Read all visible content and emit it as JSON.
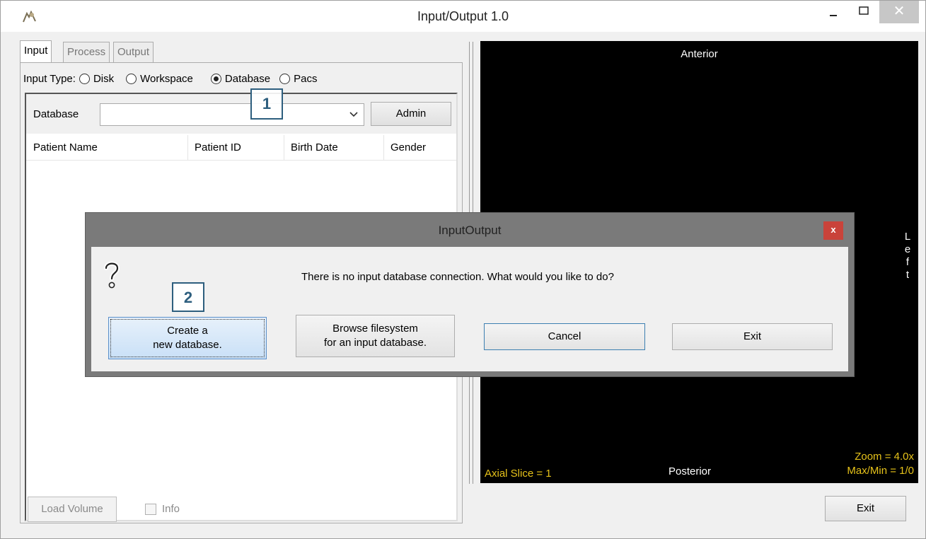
{
  "window": {
    "title": "Input/Output 1.0",
    "minimize_glyph": "–",
    "maximize_glyph": "□",
    "close_glyph": "✕"
  },
  "tabs": [
    {
      "label": "Input",
      "active": true
    },
    {
      "label": "Process",
      "active": false
    },
    {
      "label": "Output",
      "active": false
    }
  ],
  "input_type": {
    "label": "Input Type:",
    "options": [
      "Disk",
      "Workspace",
      "Database",
      "Pacs"
    ],
    "selected": "Database"
  },
  "database": {
    "label": "Database",
    "value": "",
    "admin_label": "Admin"
  },
  "table": {
    "columns": [
      "Patient Name",
      "Patient ID",
      "Birth Date",
      "Gender"
    ],
    "rows": []
  },
  "viewer": {
    "top_label": "Anterior",
    "bottom_label": "Posterior",
    "side_label_letters": [
      "L",
      "e",
      "f",
      "t"
    ],
    "slice_text": "Axial Slice = 1",
    "zoom_text": "Zoom = 4.0x",
    "maxmin_text": "Max/Min = 1/0",
    "overlay_color": "#e6c21a"
  },
  "bottom": {
    "load_volume_label": "Load Volume",
    "info_label": "Info",
    "exit_label": "Exit"
  },
  "dialog": {
    "title": "InputOutput",
    "close_glyph": "x",
    "icon": "question-mark-icon",
    "message": "There is no input database connection. What would you like to do?",
    "buttons": {
      "create_line1": "Create a",
      "create_line2": "new database.",
      "browse_line1": "Browse filesystem",
      "browse_line2": "for an input database.",
      "cancel": "Cancel",
      "exit": "Exit"
    }
  },
  "markers": [
    "1",
    "2"
  ]
}
